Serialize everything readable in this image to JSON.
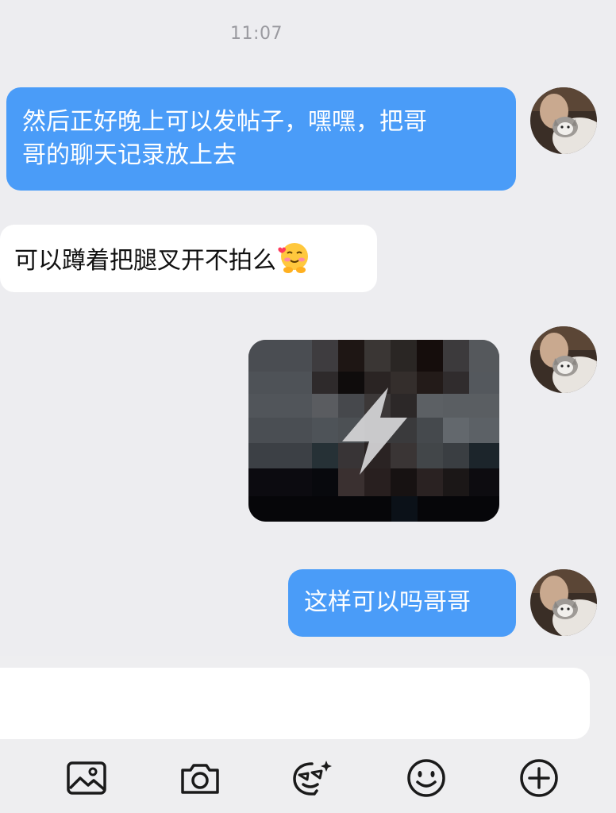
{
  "status": {
    "time": "11:07"
  },
  "messages": [
    {
      "side": "out",
      "text_line1": "然后正好晚上可以发帖子，嘿嘿，把哥",
      "text_line2": "哥的聊天记录放上去"
    },
    {
      "side": "in",
      "text": "可以蹲着把腿叉开不拍么",
      "trailing_emoji": "blushing-hug-emoji"
    },
    {
      "side": "out",
      "type": "media",
      "media_kind": "flash-photo",
      "icon": "lightning-bolt-icon"
    },
    {
      "side": "out",
      "text": "这样可以吗哥哥"
    }
  ],
  "toolbar": {
    "icons": [
      "image-icon",
      "camera-icon",
      "sticker-icon",
      "emoji-icon",
      "plus-icon"
    ]
  },
  "colors": {
    "outgoing_bubble": "#4a9cf8",
    "incoming_bubble": "#ffffff",
    "background": "#ededf0",
    "timestamp": "#9a9aa0"
  }
}
